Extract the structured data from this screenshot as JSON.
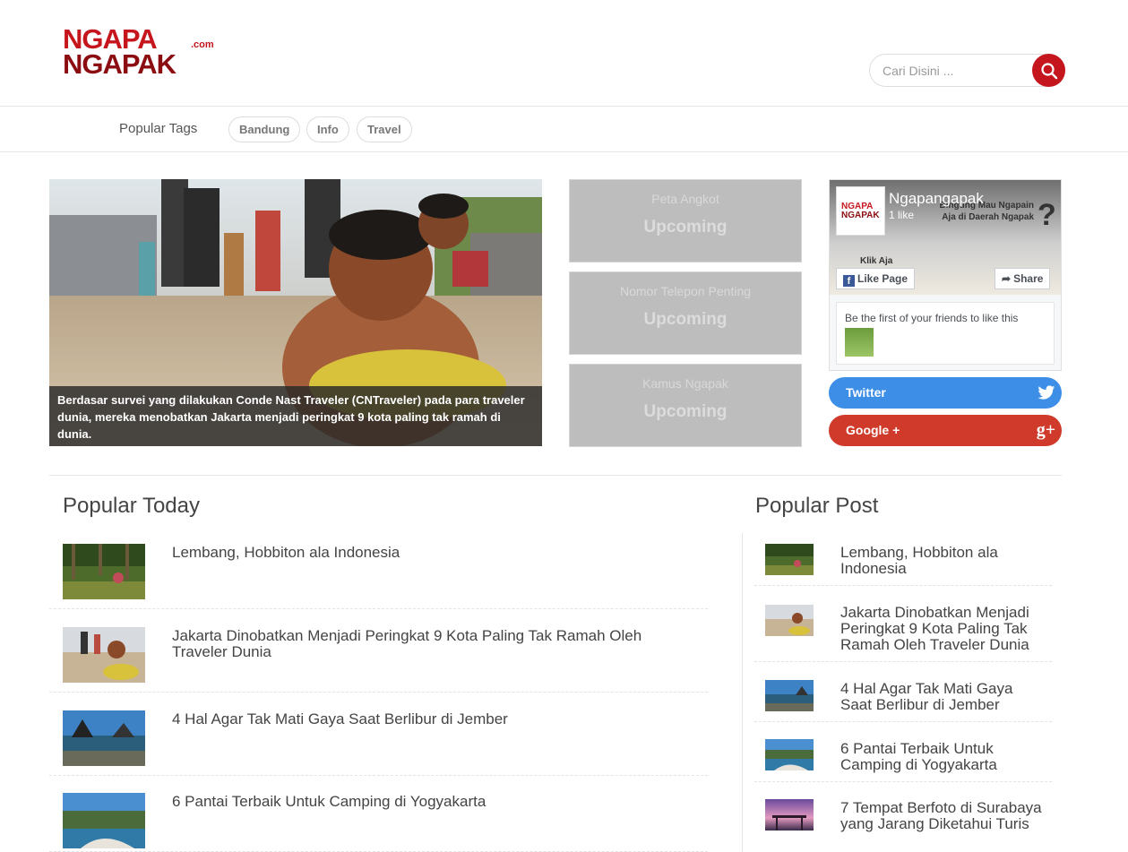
{
  "header": {
    "logo_line1": "NGAPA",
    "logo_line2": "NGAPAK",
    "logo_com": ".com",
    "search_placeholder": "Cari Disini ...",
    "search_icon": "search-icon",
    "brand_color": "#c4161c"
  },
  "tags": {
    "label": "Popular Tags",
    "items": [
      "Bandung",
      "Info",
      "Travel"
    ]
  },
  "hero": {
    "caption": "Berdasar survei yang dilakukan Conde Nast Traveler (CNTraveler) pada para traveler dunia, mereka menobatkan Jakarta menjadi peringkat 9 kota paling tak ramah di dunia."
  },
  "upcoming": [
    {
      "title": "Peta Angkot",
      "status": "Upcoming"
    },
    {
      "title": "Nomor Telepon Penting",
      "status": "Upcoming"
    },
    {
      "title": "Kamus Ngapak",
      "status": "Upcoming"
    }
  ],
  "facebook": {
    "page_name": "Ngapangapak",
    "likes": "1 like",
    "tagline": "Bingung Mau Ngapain Aja di Daerah Ngapak",
    "question": "?",
    "klik": "Klik Aja",
    "like_button": "Like Page",
    "share_button": "Share",
    "friends_text": "Be the first of your friends to like this",
    "avatar_line1": "NGAPA",
    "avatar_line2": "NGAPAK",
    "color": "#3b5998"
  },
  "social": {
    "twitter_label": "Twitter",
    "twitter_color": "#3d8ee6",
    "google_label": "Google +",
    "google_color": "#d03a2a"
  },
  "popular_today": {
    "title": "Popular Today",
    "items": [
      "Lembang, Hobbiton ala Indonesia",
      "Jakarta Dinobatkan Menjadi Peringkat 9 Kota Paling Tak Ramah Oleh Traveler Dunia",
      "4 Hal Agar Tak Mati Gaya Saat Berlibur di Jember",
      "6 Pantai Terbaik Untuk Camping di Yogyakarta"
    ]
  },
  "popular_post": {
    "title": "Popular Post",
    "items": [
      "Lembang, Hobbiton ala Indonesia",
      "Jakarta Dinobatkan Menjadi Peringkat 9 Kota Paling Tak Ramah Oleh Traveler Dunia",
      "4 Hal Agar Tak Mati Gaya Saat Berlibur di Jember",
      "6 Pantai Terbaik Untuk Camping di Yogyakarta",
      "7 Tempat Berfoto di Surabaya yang Jarang Diketahui Turis"
    ]
  }
}
